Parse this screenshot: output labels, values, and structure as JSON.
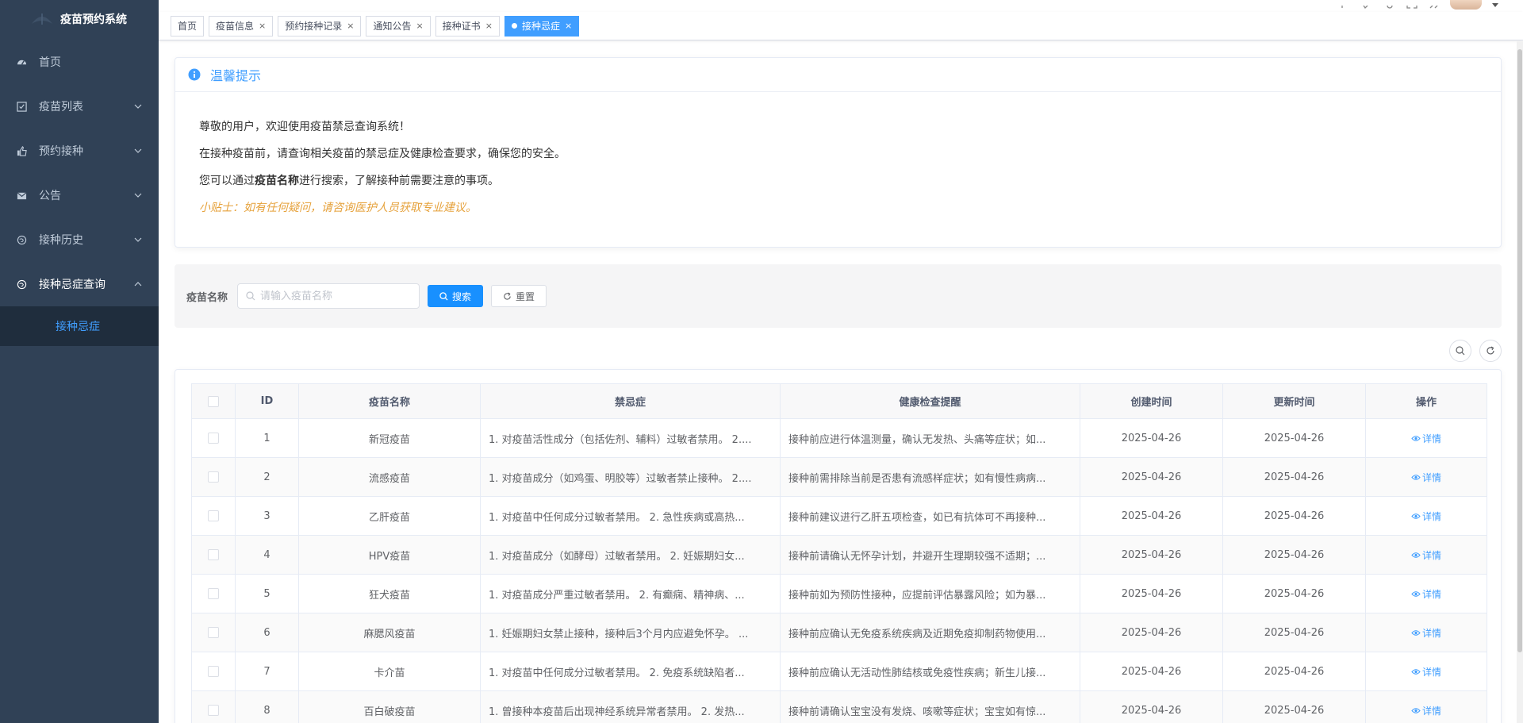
{
  "app": {
    "title": "疫苗预约系统"
  },
  "sidebar": {
    "items": [
      {
        "label": "首页",
        "icon": "dashboard-icon",
        "has_children": false
      },
      {
        "label": "疫苗列表",
        "icon": "checkbox-icon",
        "has_children": true
      },
      {
        "label": "预约接种",
        "icon": "thumb-up-icon",
        "has_children": true
      },
      {
        "label": "公告",
        "icon": "message-icon",
        "has_children": true
      },
      {
        "label": "接种历史",
        "icon": "globe-icon",
        "has_children": true
      },
      {
        "label": "接种忌症查询",
        "icon": "globe-icon",
        "has_children": true,
        "open": true
      }
    ],
    "active_sub": "接种忌症"
  },
  "tags": [
    {
      "label": "首页",
      "closable": false
    },
    {
      "label": "疫苗信息",
      "closable": true
    },
    {
      "label": "预约接种记录",
      "closable": true
    },
    {
      "label": "通知公告",
      "closable": true
    },
    {
      "label": "接种证书",
      "closable": true
    },
    {
      "label": "接种忌症",
      "closable": true,
      "active": true
    }
  ],
  "tip": {
    "title": "温馨提示",
    "line1": "尊敬的用户，欢迎使用疫苗禁忌查询系统！",
    "line2": "在接种疫苗前，请查询相关疫苗的禁忌症及健康检查要求，确保您的安全。",
    "line3_pre": "您可以通过",
    "line3_bold": "疫苗名称",
    "line3_post": "进行搜索，了解接种前需要注意的事项。",
    "hint": "小贴士：如有任何疑问，请咨询医护人员获取专业建议。"
  },
  "search": {
    "label": "疫苗名称",
    "placeholder": "请输入疫苗名称",
    "value": "",
    "search_btn": "搜索",
    "reset_btn": "重置"
  },
  "table": {
    "headers": {
      "id": "ID",
      "name": "疫苗名称",
      "contra": "禁忌症",
      "health": "健康检查提醒",
      "created": "创建时间",
      "updated": "更新时间",
      "action": "操作"
    },
    "action_label": "详情",
    "rows": [
      {
        "id": "1",
        "name": "新冠疫苗",
        "contra": "1. 对疫苗活性成分（包括佐剂、辅料）过敏者禁用。 2....",
        "health": "接种前应进行体温测量，确认无发热、头痛等症状；如...",
        "created": "2025-04-26",
        "updated": "2025-04-26"
      },
      {
        "id": "2",
        "name": "流感疫苗",
        "contra": "1. 对疫苗成分（如鸡蛋、明胶等）过敏者禁止接种。 2....",
        "health": "接种前需排除当前是否患有流感样症状；如有慢性病病...",
        "created": "2025-04-26",
        "updated": "2025-04-26"
      },
      {
        "id": "3",
        "name": "乙肝疫苗",
        "contra": "1. 对疫苗中任何成分过敏者禁用。 2. 急性疾病或高热...",
        "health": "接种前建议进行乙肝五项检查，如已有抗体可不再接种...",
        "created": "2025-04-26",
        "updated": "2025-04-26"
      },
      {
        "id": "4",
        "name": "HPV疫苗",
        "contra": "1. 对疫苗成分（如酵母）过敏者禁用。 2. 妊娠期妇女...",
        "health": "接种前请确认无怀孕计划，并避开生理期较强不适期；...",
        "created": "2025-04-26",
        "updated": "2025-04-26"
      },
      {
        "id": "5",
        "name": "狂犬疫苗",
        "contra": "1. 对疫苗成分严重过敏者禁用。 2. 有癫痫、精神病、...",
        "health": "接种前如为预防性接种，应提前评估暴露风险；如为暴...",
        "created": "2025-04-26",
        "updated": "2025-04-26"
      },
      {
        "id": "6",
        "name": "麻腮风疫苗",
        "contra": "1. 妊娠期妇女禁止接种，接种后3个月内应避免怀孕。 ...",
        "health": "接种前应确认无免疫系统疾病及近期免疫抑制药物使用...",
        "created": "2025-04-26",
        "updated": "2025-04-26"
      },
      {
        "id": "7",
        "name": "卡介苗",
        "contra": "1. 对疫苗中任何成分过敏者禁用。 2. 免疫系统缺陷者...",
        "health": "接种前应确认无活动性肺结核或免疫性疾病；新生儿接...",
        "created": "2025-04-26",
        "updated": "2025-04-26"
      },
      {
        "id": "8",
        "name": "百白破疫苗",
        "contra": "1. 曾接种本疫苗后出现神经系统异常者禁用。 2. 发热...",
        "health": "接种前请确认宝宝没有发烧、咳嗽等症状；宝宝如有惊...",
        "created": "2025-04-26",
        "updated": "2025-04-26"
      }
    ]
  },
  "colors": {
    "sidebar_bg": "#304156",
    "submenu_bg": "#1f2d3d",
    "primary": "#409eff",
    "hint": "#e6a23c"
  }
}
